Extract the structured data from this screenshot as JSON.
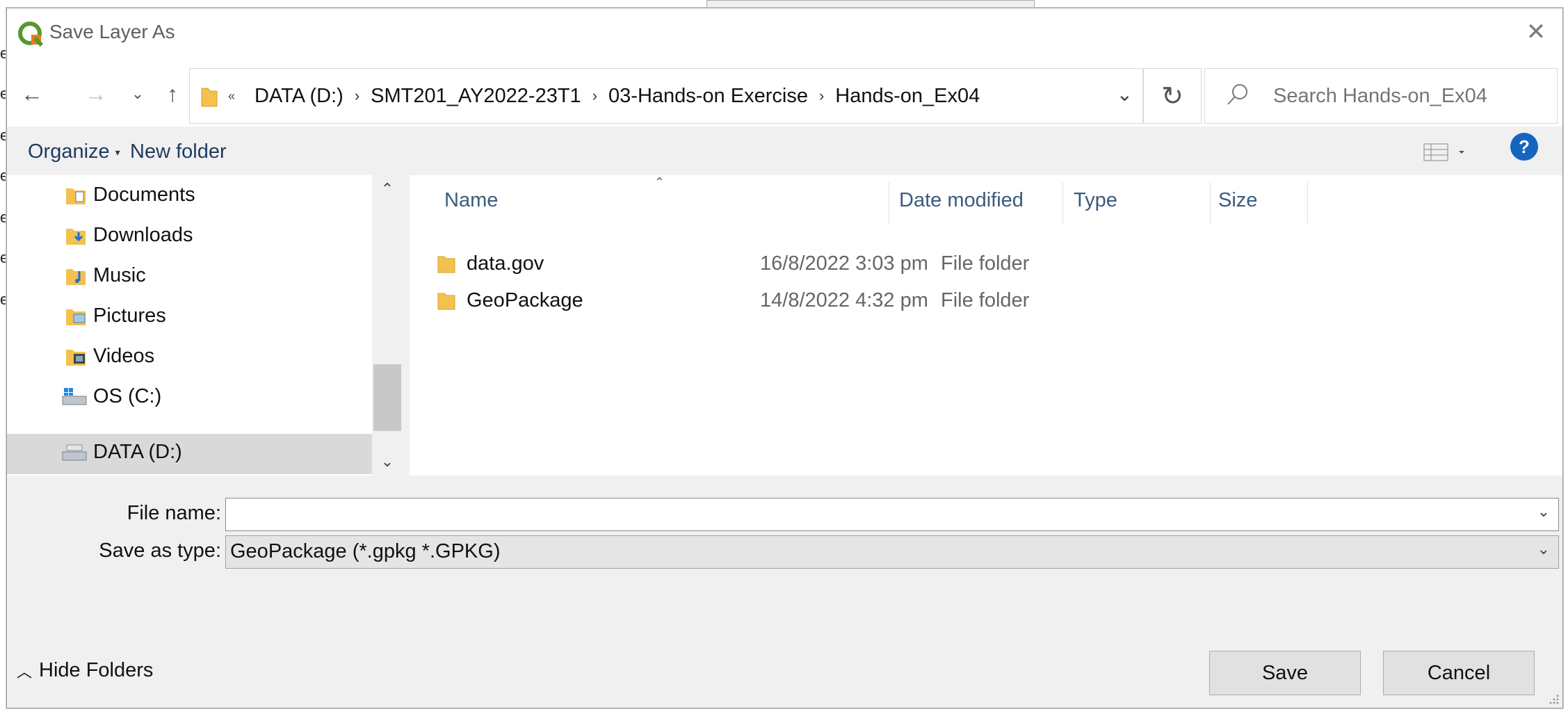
{
  "window": {
    "title": "Save Layer As"
  },
  "nav": {
    "back_icon": "arrow-left-icon",
    "forward_icon": "arrow-right-icon",
    "recent_icon": "chevron-down-icon",
    "up_icon": "arrow-up-icon",
    "overflow": "«",
    "breadcrumbs": [
      "DATA (D:)",
      "SMT201_AY2022-23T1",
      "03-Hands-on Exercise",
      "Hands-on_Ex04"
    ],
    "refresh_icon": "refresh-icon"
  },
  "search": {
    "placeholder": "Search Hands-on_Ex04"
  },
  "toolbar": {
    "organize": "Organize",
    "new_folder": "New folder",
    "help": "?"
  },
  "sidebar": {
    "items": [
      {
        "label": "Documents",
        "icon": "documents-folder-icon"
      },
      {
        "label": "Downloads",
        "icon": "downloads-folder-icon"
      },
      {
        "label": "Music",
        "icon": "music-folder-icon"
      },
      {
        "label": "Pictures",
        "icon": "pictures-folder-icon"
      },
      {
        "label": "Videos",
        "icon": "videos-folder-icon"
      },
      {
        "label": "OS (C:)",
        "icon": "os-drive-icon"
      },
      {
        "label": "DATA (D:)",
        "icon": "drive-icon",
        "selected": true
      }
    ]
  },
  "files": {
    "columns": {
      "name": "Name",
      "date": "Date modified",
      "type": "Type",
      "size": "Size"
    },
    "rows": [
      {
        "name": "data.gov",
        "date": "16/8/2022 3:03 pm",
        "type": "File folder"
      },
      {
        "name": "GeoPackage",
        "date": "14/8/2022 4:32 pm",
        "type": "File folder"
      }
    ]
  },
  "form": {
    "file_name_label": "File name:",
    "file_name_value": "",
    "save_type_label": "Save as type:",
    "save_type_value": "GeoPackage (*.gpkg *.GPKG)"
  },
  "footer": {
    "hide_folders": "Hide Folders",
    "save": "Save",
    "cancel": "Cancel"
  },
  "colors": {
    "accent": "#1565c0",
    "header_text": "#3b5b7c",
    "selection": "#d9d9d9"
  }
}
